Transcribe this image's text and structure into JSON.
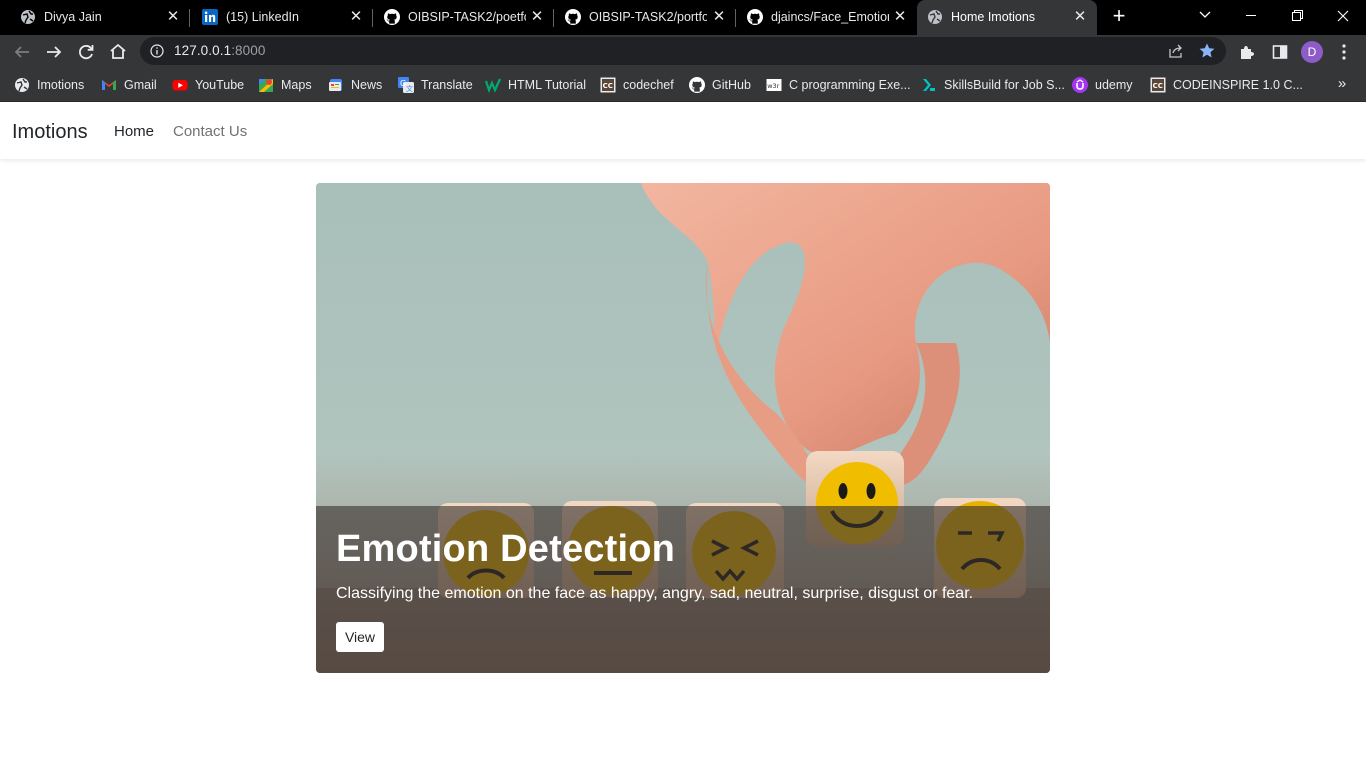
{
  "browser": {
    "tabs": [
      {
        "label": "Divya Jain",
        "icon": "globe-icon"
      },
      {
        "label": "(15) LinkedIn",
        "icon": "linkedin-icon"
      },
      {
        "label": "OIBSIP-TASK2/poetfol",
        "icon": "github-icon"
      },
      {
        "label": "OIBSIP-TASK2/portfoli",
        "icon": "github-icon"
      },
      {
        "label": "djaincs/Face_Emotion_",
        "icon": "github-icon"
      },
      {
        "label": "Home Imotions",
        "icon": "globe-icon",
        "active": true
      }
    ],
    "address": {
      "host": "127.0.0.1",
      "port": ":8000"
    },
    "profile_initial": "D",
    "accent_color": "#8ab4f8",
    "bookmarks": [
      {
        "label": "Imotions",
        "icon": "globe-icon"
      },
      {
        "label": "Gmail",
        "icon": "gmail-icon"
      },
      {
        "label": "YouTube",
        "icon": "youtube-icon"
      },
      {
        "label": "Maps",
        "icon": "maps-icon"
      },
      {
        "label": "News",
        "icon": "news-icon"
      },
      {
        "label": "Translate",
        "icon": "translate-icon"
      },
      {
        "label": "HTML Tutorial",
        "icon": "w3-icon"
      },
      {
        "label": "codechef",
        "icon": "codechef-icon"
      },
      {
        "label": "GitHub",
        "icon": "github-icon"
      },
      {
        "label": "C programming Exe...",
        "icon": "w3r-icon"
      },
      {
        "label": "SkillsBuild for Job S...",
        "icon": "skillsbuild-icon"
      },
      {
        "label": "udemy",
        "icon": "udemy-icon"
      },
      {
        "label": "CODEINSPIRE 1.0 C...",
        "icon": "codechef-icon"
      }
    ]
  },
  "site": {
    "brand": "Imotions",
    "nav": {
      "home": "Home",
      "contact": "Contact Us"
    },
    "hero": {
      "title": "Emotion Detection",
      "text": "Classifying the emotion on the face as happy, angry, sad, neutral, surprise, disgust or fear.",
      "button": "View"
    }
  }
}
